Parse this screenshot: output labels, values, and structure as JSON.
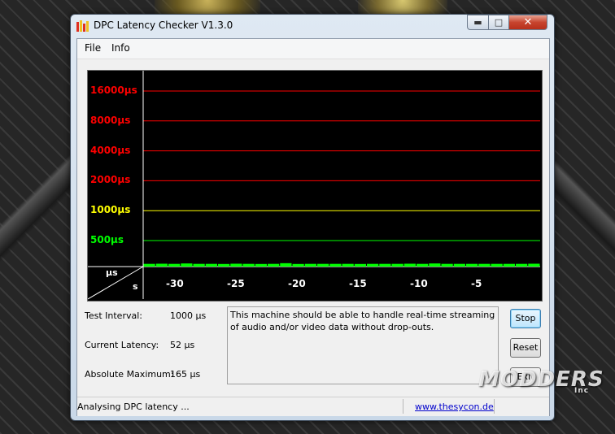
{
  "window": {
    "title": "DPC Latency Checker V1.3.0",
    "minimize_glyph": "▬",
    "maximize_glyph": "□",
    "close_glyph": "✕"
  },
  "menu": [
    {
      "label": "File"
    },
    {
      "label": "Info"
    }
  ],
  "chart_data": {
    "type": "bar",
    "y_scale": "log",
    "y_levels": [
      {
        "label": "16000µs",
        "value": 16000,
        "color": "#ff0000"
      },
      {
        "label": "8000µs",
        "value": 8000,
        "color": "#ff0000"
      },
      {
        "label": "4000µs",
        "value": 4000,
        "color": "#ff0000"
      },
      {
        "label": "2000µs",
        "value": 2000,
        "color": "#ff0000"
      },
      {
        "label": "1000µs",
        "value": 1000,
        "color": "#ffff00"
      },
      {
        "label": "500µs",
        "value": 500,
        "color": "#00ff00"
      }
    ],
    "x_ticks": [
      "-30",
      "-25",
      "-20",
      "-15",
      "-10",
      "-5"
    ],
    "x_units": "s",
    "y_units": "µs",
    "bar_color": "#00ff00",
    "values": [
      52,
      55,
      52,
      60,
      52,
      52,
      50,
      55,
      52,
      50,
      52,
      65,
      50,
      52,
      52,
      52,
      52,
      50,
      52,
      52,
      52,
      55,
      52,
      60,
      52,
      52,
      52,
      52,
      52,
      52,
      52,
      55
    ]
  },
  "info": {
    "test_interval_label": "Test Interval:",
    "test_interval_value": "1000 µs",
    "current_latency_label": "Current Latency:",
    "current_latency_value": "52 µs",
    "absolute_maximum_label": "Absolute Maximum:",
    "absolute_maximum_value": "165 µs",
    "message": "This machine should be able to handle real-time streaming of audio and/or video data without drop-outs."
  },
  "buttons": {
    "stop": "Stop",
    "reset": "Reset",
    "exit": "Exit"
  },
  "status": {
    "text": "Analysing DPC latency ...",
    "link": "www.thesycon.de"
  },
  "watermark": {
    "brand": "MODDERS",
    "suffix": "Inc"
  }
}
